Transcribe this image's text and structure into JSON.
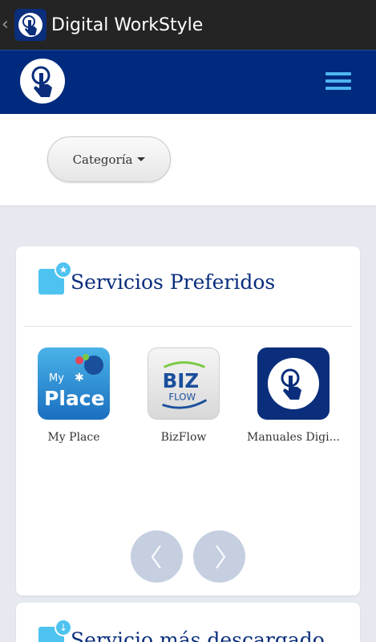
{
  "actionbar": {
    "back_glyph": "‹",
    "title": "Digital WorkStyle"
  },
  "category": {
    "label": "Categoría"
  },
  "preferred": {
    "title": "Servicios Preferidos",
    "apps": [
      {
        "label": "My Place",
        "tile_text_top": "My",
        "tile_text_bottom": "Place"
      },
      {
        "label": "BizFlow",
        "tile_text_top": "BIZ",
        "tile_text_bottom": "FLOW"
      },
      {
        "label": "Manuales Digi..."
      }
    ]
  },
  "downloaded": {
    "title": "Servicio más descargado"
  },
  "colors": {
    "header": "#002a7e",
    "accent": "#4ec3f0",
    "title_text": "#0a2e7c"
  }
}
